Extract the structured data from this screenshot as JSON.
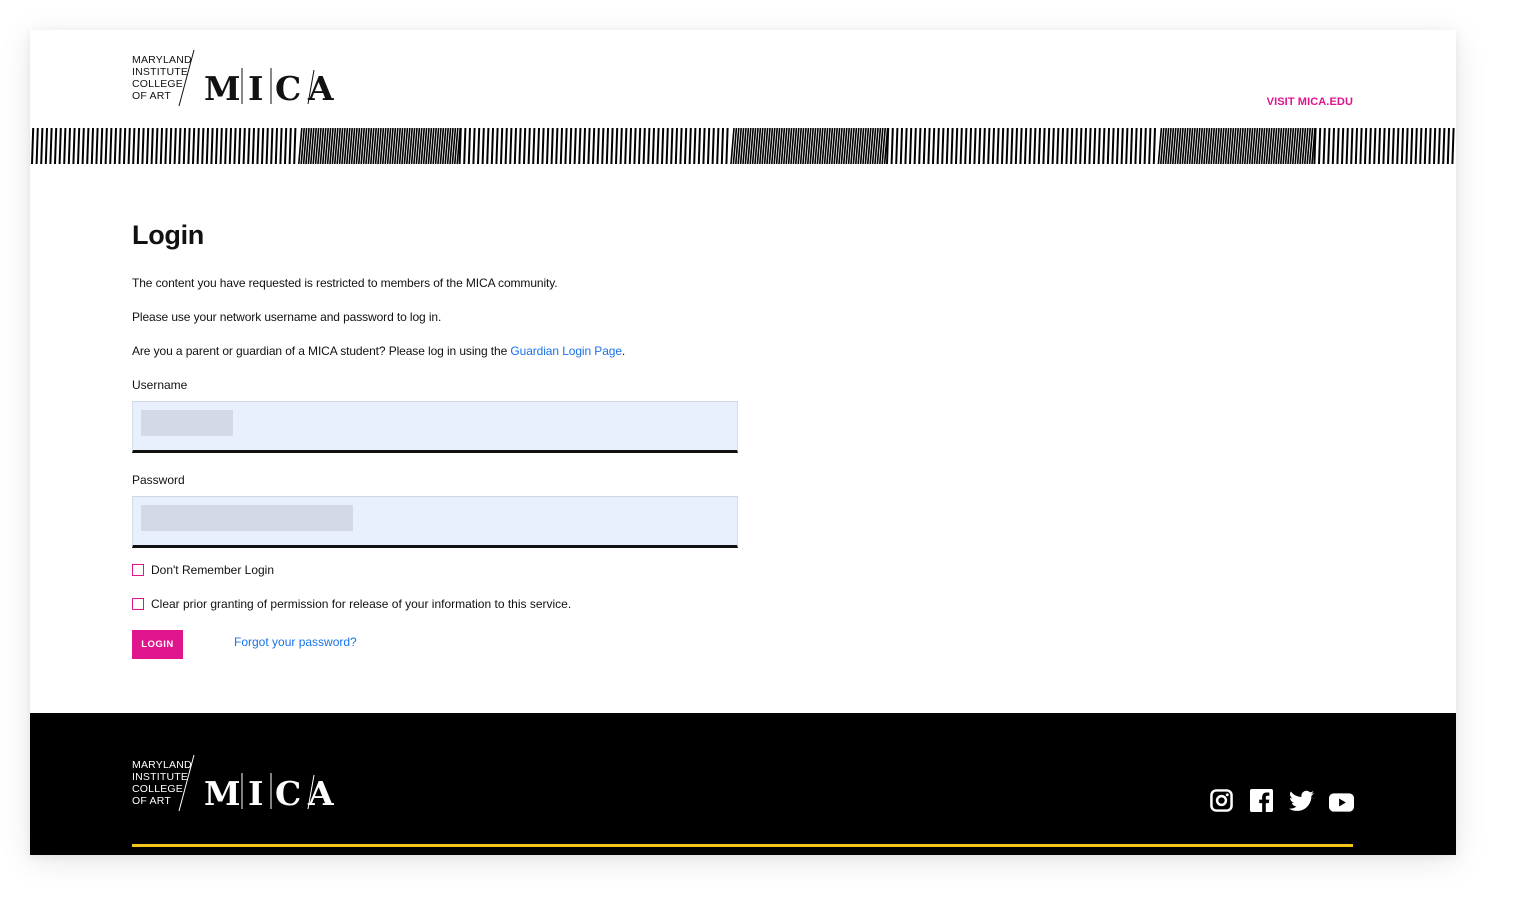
{
  "header": {
    "logo": {
      "lines": [
        "MARYLAND",
        "INSTITUTE",
        "COLLEGE",
        "OF ART"
      ],
      "wordmark": "MICA"
    },
    "visit_link": "VISIT MICA.EDU"
  },
  "main": {
    "title": "Login",
    "paragraph_1": "The content you have requested is restricted to members of the MICA community.",
    "paragraph_2": "Please use your network username and password to log in.",
    "paragraph_3_prefix": "Are you a parent or guardian of a MICA student? Please log in using the",
    "guardian_link": "Guardian Login Page",
    "paragraph_3_suffix": ".",
    "username_label": "Username",
    "password_label": "Password",
    "dont_remember_label": "Don't Remember Login",
    "clear_permission_label": "Clear prior granting of permission for release of your information to this service.",
    "login_button": "LOGIN",
    "forgot_link": "Forgot your password?"
  },
  "footer": {
    "logo": {
      "lines": [
        "MARYLAND",
        "INSTITUTE",
        "COLLEGE",
        "OF ART"
      ],
      "wordmark": "MICA"
    },
    "social_icons": [
      "instagram-icon",
      "facebook-icon",
      "twitter-icon",
      "youtube-icon"
    ]
  },
  "colors": {
    "accent": "#e0148c",
    "link": "#1a73e8",
    "footer_bg": "#000000",
    "footer_line": "#f2c318",
    "field_bg": "#e8f0fe"
  }
}
